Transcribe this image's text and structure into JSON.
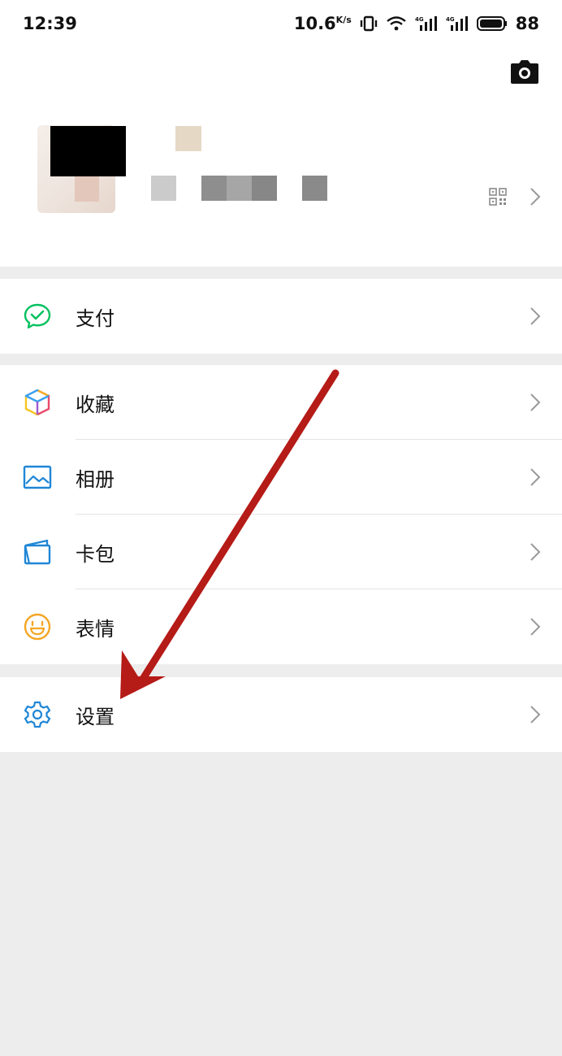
{
  "status_bar": {
    "time": "12:39",
    "speed": "10.6",
    "speed_unit": "K/s",
    "battery": "88",
    "icons": [
      "vibrate-icon",
      "wifi-icon",
      "signal-4g-icon",
      "signal-4g-icon",
      "battery-icon"
    ]
  },
  "profile": {
    "icons": [
      "camera-icon",
      "qr-code-icon",
      "chevron-right-icon"
    ]
  },
  "menu": {
    "pay": {
      "label": "支付",
      "icon": "wechat-pay-icon",
      "color": "#07c160"
    },
    "favorites": {
      "label": "收藏",
      "icon": "favorites-cube-icon"
    },
    "album": {
      "label": "相册",
      "icon": "album-picture-icon",
      "color": "#1f86d6"
    },
    "cards": {
      "label": "卡包",
      "icon": "card-wallet-icon",
      "color": "#1f86d6"
    },
    "stickers": {
      "label": "表情",
      "icon": "smiley-icon",
      "color": "#f5a623"
    },
    "settings": {
      "label": "设置",
      "icon": "gear-icon",
      "color": "#1f86d6"
    }
  },
  "annotation": {
    "arrow_color": "#b51b17",
    "points_to": "settings"
  }
}
